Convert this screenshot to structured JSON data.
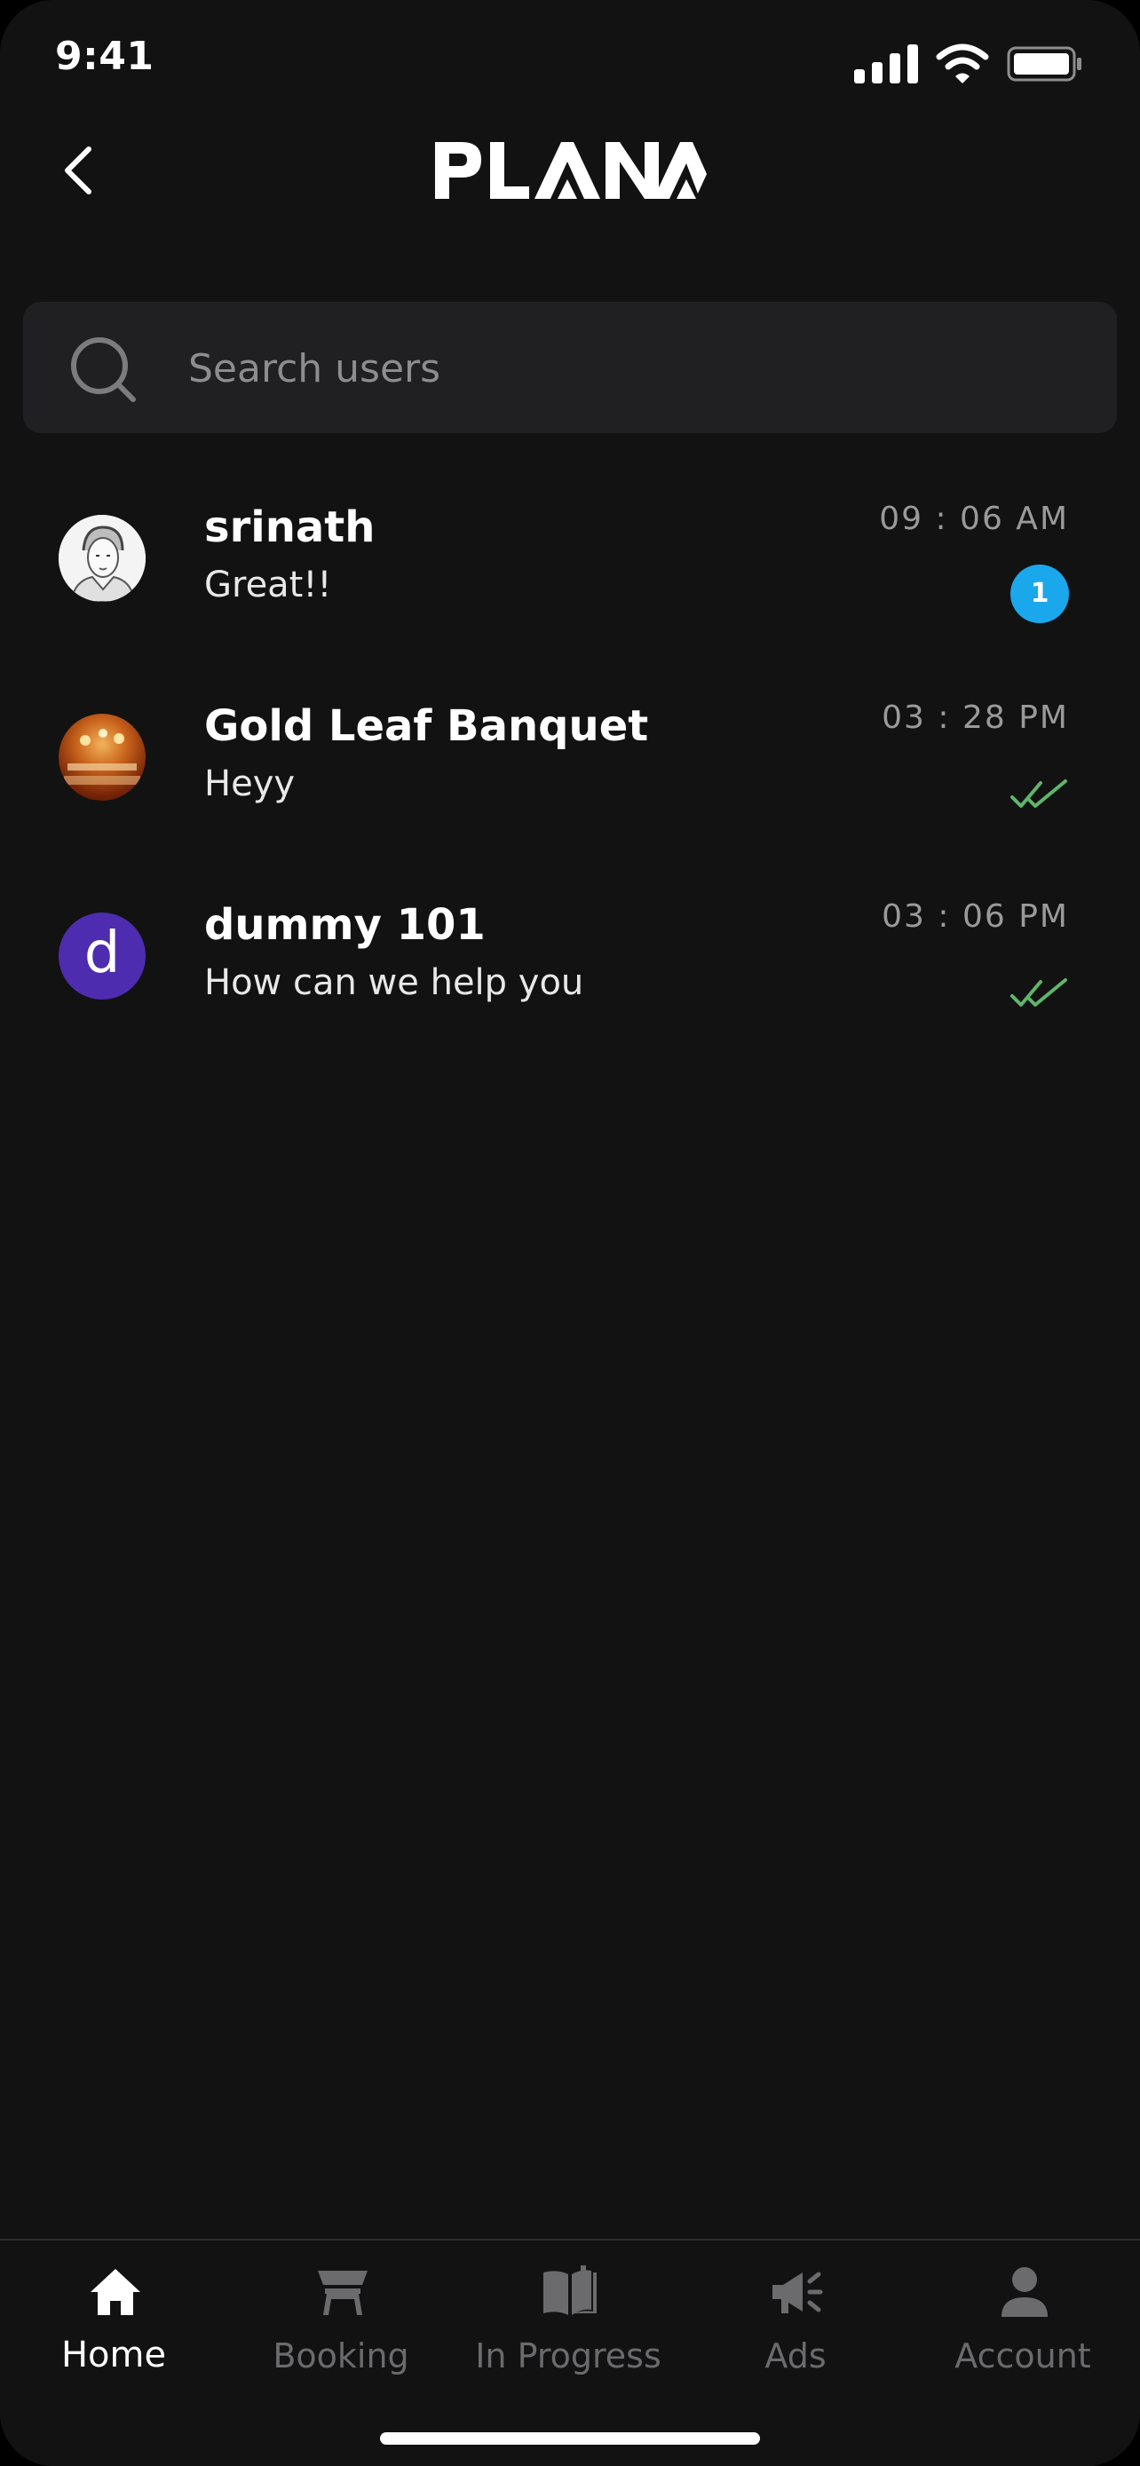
{
  "status_bar": {
    "time": "9:41"
  },
  "header": {
    "logo_text": "PLANA"
  },
  "search": {
    "placeholder": "Search users"
  },
  "chats": [
    {
      "name": "srinath",
      "preview": "Great!!",
      "time": "09 : 06 AM",
      "unread": "1",
      "avatar": "sketch-portrait"
    },
    {
      "name": "Gold Leaf Banquet",
      "preview": "Heyy",
      "time": "03 : 28 PM",
      "status": "read",
      "avatar": "banquet-hall-photo"
    },
    {
      "name": "dummy 101",
      "preview": "How can we help you",
      "time": "03 : 06 PM",
      "status": "read",
      "avatar_letter": "d",
      "avatar_color": "#4e2cb0"
    }
  ],
  "nav": [
    {
      "label": "Home",
      "icon": "home-icon",
      "active": true
    },
    {
      "label": "Booking",
      "icon": "table-icon"
    },
    {
      "label": "In Progress",
      "icon": "book-icon"
    },
    {
      "label": "Ads",
      "icon": "megaphone-icon"
    },
    {
      "label": "Account",
      "icon": "person-icon"
    }
  ],
  "colors": {
    "background": "#121212",
    "search_bg": "#202022",
    "badge": "#1aa7ec",
    "read_tick": "#5fb56a",
    "nav_inactive": "#6b6b6e"
  }
}
